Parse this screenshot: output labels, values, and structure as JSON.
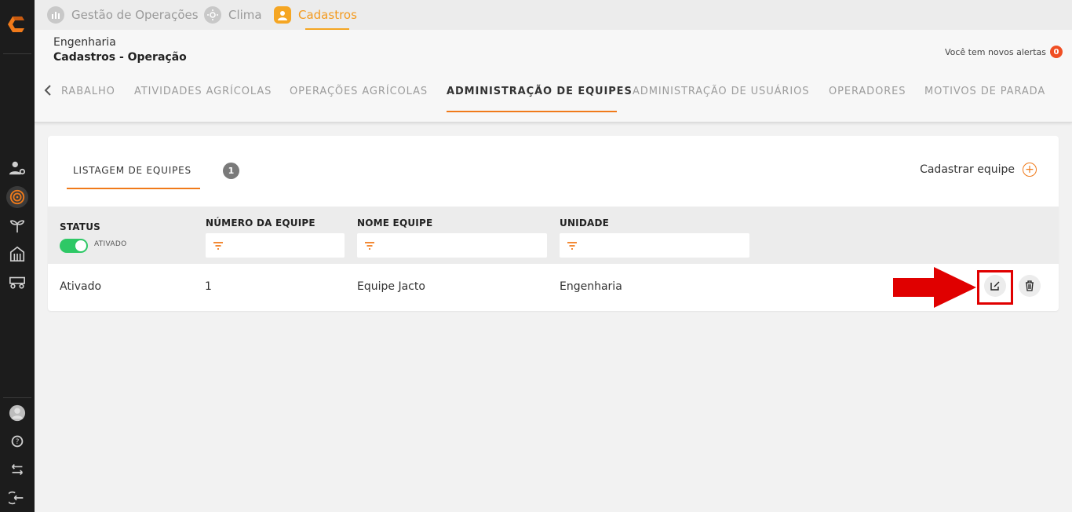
{
  "top_tabs": [
    {
      "label": "Gestão de Operações",
      "icon": "chart-icon"
    },
    {
      "label": "Clima",
      "icon": "sun-icon"
    },
    {
      "label": "Cadastros",
      "icon": "user-icon",
      "active": true
    }
  ],
  "header": {
    "breadcrumb_parent": "Engenharia",
    "breadcrumb_current": "Cadastros - Operação",
    "alerts_text": "Você tem novos alertas",
    "alerts_count": "0"
  },
  "nav_tabs": [
    {
      "label": "RABALHO"
    },
    {
      "label": "ATIVIDADES AGRÍCOLAS"
    },
    {
      "label": "OPERAÇÕES AGRÍCOLAS"
    },
    {
      "label": "ADMINISTRAÇÃO DE EQUIPES",
      "active": true
    },
    {
      "label": "ADMINISTRAÇÃO DE USUÁRIOS"
    },
    {
      "label": "OPERADORES"
    },
    {
      "label": "MOTIVOS DE PARADA"
    }
  ],
  "card": {
    "tab_label": "LISTAGEM DE EQUIPES",
    "count": "1",
    "add_label": "Cadastrar equipe"
  },
  "table": {
    "columns": [
      "STATUS",
      "NÚMERO DA EQUIPE",
      "NOME EQUIPE",
      "UNIDADE"
    ],
    "status_filter_label": "ATIVADO",
    "rows": [
      {
        "status": "Ativado",
        "numero": "1",
        "nome": "Equipe Jacto",
        "unidade": "Engenharia"
      }
    ]
  },
  "colors": {
    "accent": "#f07a1a",
    "top_active": "#f5a623",
    "toggle_on": "#2ec866",
    "highlight": "#e00000",
    "sidebar_bg": "#1c1c1c"
  }
}
